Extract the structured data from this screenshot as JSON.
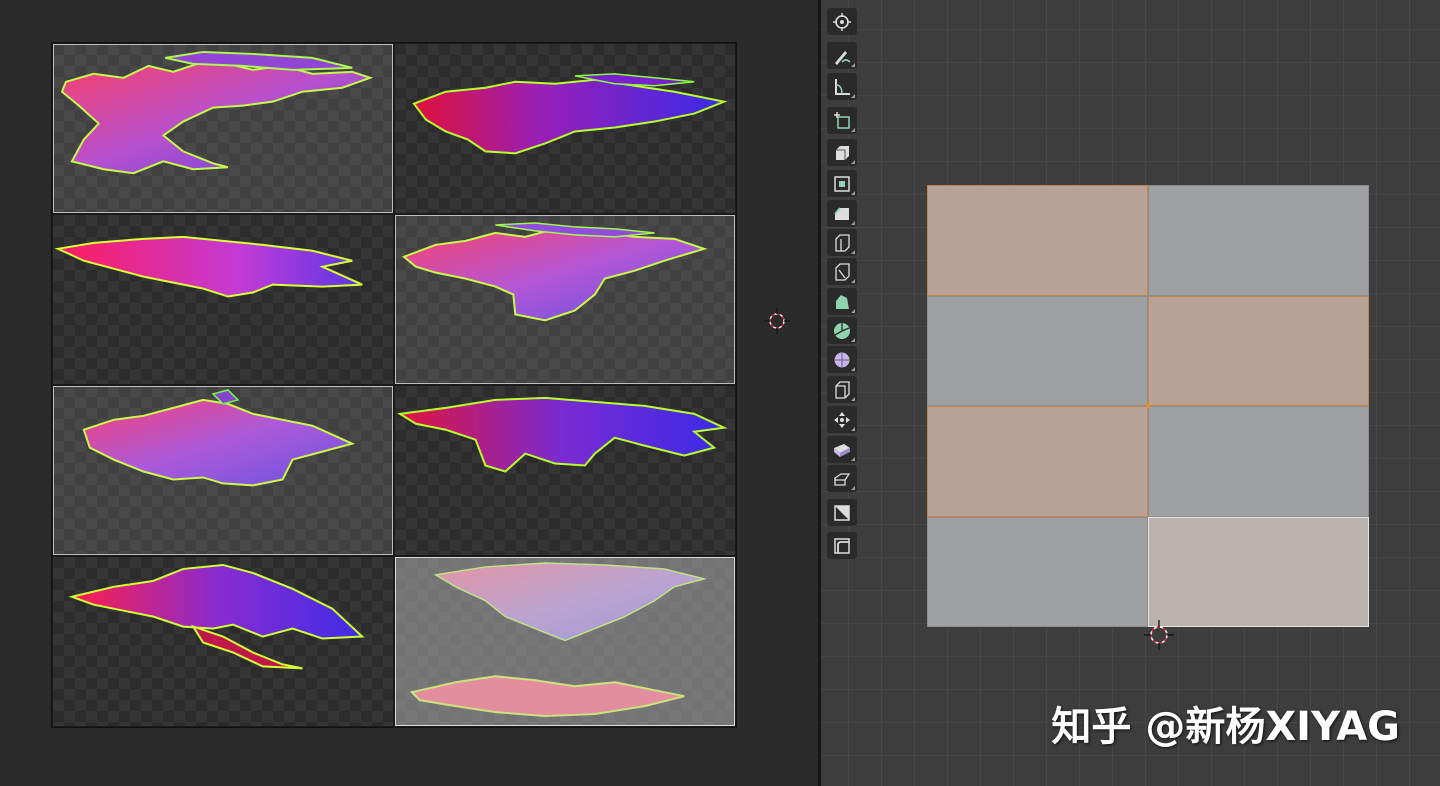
{
  "uv_editor": {
    "tiles": [
      {
        "id": "tile-1",
        "state": "selected"
      },
      {
        "id": "tile-2",
        "state": "normal"
      },
      {
        "id": "tile-3",
        "state": "normal"
      },
      {
        "id": "tile-4",
        "state": "selected"
      },
      {
        "id": "tile-5",
        "state": "selected"
      },
      {
        "id": "tile-6",
        "state": "normal"
      },
      {
        "id": "tile-7",
        "state": "normal"
      },
      {
        "id": "tile-8",
        "state": "active"
      }
    ]
  },
  "toolbar": {
    "tools": [
      {
        "name": "cursor-tool",
        "icon": "cursor-icon"
      },
      {
        "name": "annotate-tool",
        "icon": "annotate-icon"
      },
      {
        "name": "measure-tool",
        "icon": "measure-icon"
      },
      {
        "name": "add-cube-tool",
        "icon": "add-cube-icon"
      },
      {
        "name": "extrude-tool",
        "icon": "extrude-icon"
      },
      {
        "name": "inset-tool",
        "icon": "inset-icon"
      },
      {
        "name": "bevel-tool",
        "icon": "bevel-icon"
      },
      {
        "name": "loop-cut-tool",
        "icon": "loop-cut-icon"
      },
      {
        "name": "knife-tool",
        "icon": "knife-icon"
      },
      {
        "name": "poly-build-tool",
        "icon": "poly-build-icon"
      },
      {
        "name": "spin-tool",
        "icon": "spin-icon"
      },
      {
        "name": "smooth-tool",
        "icon": "smooth-icon"
      },
      {
        "name": "edge-slide-tool",
        "icon": "edge-slide-icon"
      },
      {
        "name": "shrink-fatten-tool",
        "icon": "shrink-fatten-icon"
      },
      {
        "name": "shear-tool",
        "icon": "shear-icon"
      },
      {
        "name": "rip-region-tool",
        "icon": "rip-region-icon"
      },
      {
        "name": "uv-tool-a",
        "icon": "uv-square-icon"
      },
      {
        "name": "uv-tool-b",
        "icon": "uv-corner-icon"
      }
    ]
  },
  "mesh": {
    "faces": [
      "sel",
      "normal",
      "normal",
      "sel",
      "sel",
      "normal",
      "normal",
      "act"
    ]
  },
  "colors": {
    "selected_face": "#b7a298",
    "selected_edge": "#c4844a",
    "active_face": "#bab2ad",
    "unselected_face": "#9fa0a1"
  },
  "watermark": "知乎 @新杨XIYAG"
}
